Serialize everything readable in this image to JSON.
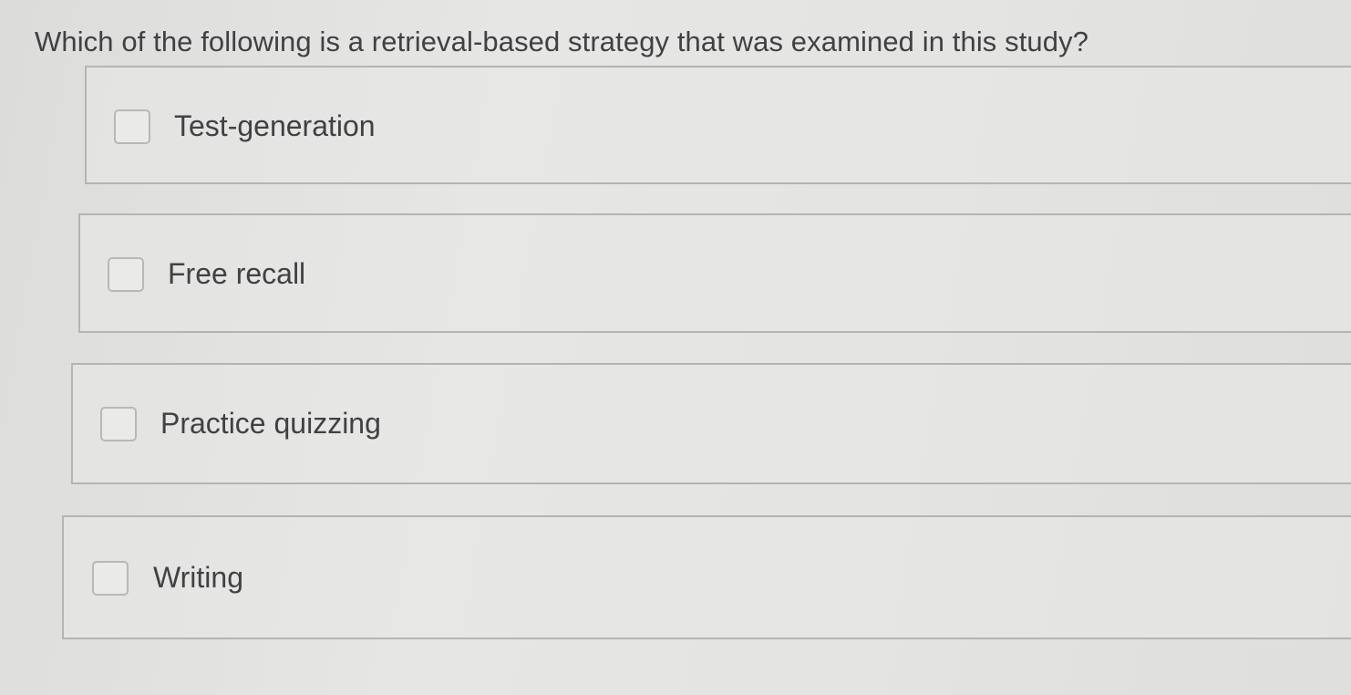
{
  "question": {
    "text": "Which of the following is a retrieval-based strategy that was examined in this study?"
  },
  "options": [
    {
      "label": "Test-generation",
      "checked": false
    },
    {
      "label": "Free recall",
      "checked": false
    },
    {
      "label": "Practice quizzing",
      "checked": false
    },
    {
      "label": "Writing",
      "checked": false
    }
  ]
}
